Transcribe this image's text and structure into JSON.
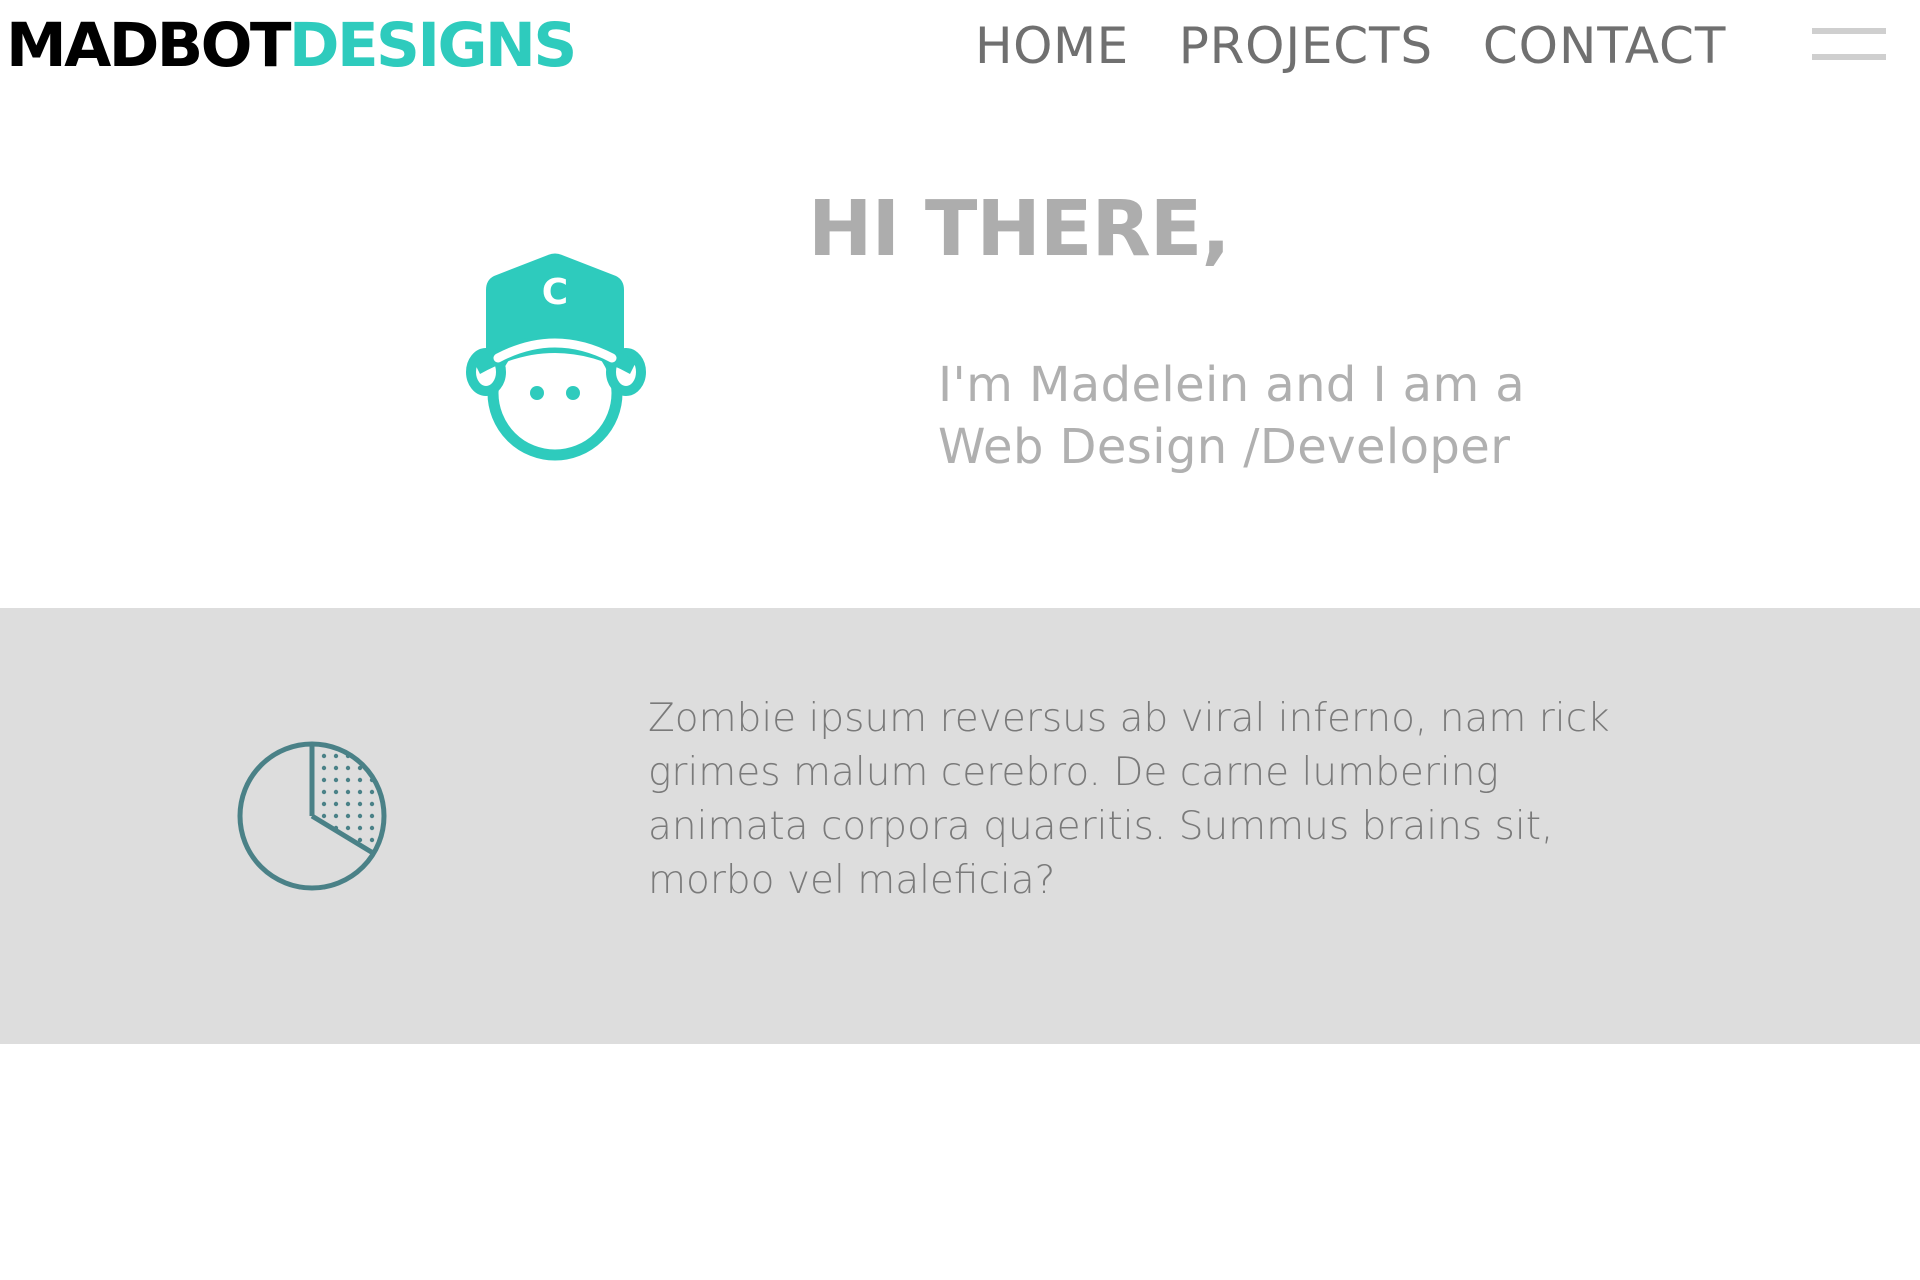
{
  "logo": {
    "part1": "MADBOT",
    "part2": "DESIGNS"
  },
  "nav": {
    "items": [
      {
        "label": "HOME"
      },
      {
        "label": "PROJECTS"
      },
      {
        "label": "CONTACT"
      }
    ],
    "menu_icon": "hamburger-menu-icon"
  },
  "hero": {
    "title": "HI THERE,",
    "subtitle_lines": [
      "I'm Madelein and I am a",
      "Web Design /Developer"
    ],
    "avatar_icon": "boy-with-cap-icon",
    "avatar_cap_letter": "C"
  },
  "about": {
    "icon": "pie-chart-icon",
    "text_lines": [
      "Zombie ipsum reversus ab viral inferno, nam rick",
      "grimes malum cerebro. De carne lumbering",
      "animata corpora quaeritis. Summus brains sit,",
      "morbo vel maleficia?"
    ]
  },
  "colors": {
    "accent": "#2ecbbd",
    "logo_dark": "#000000",
    "nav_text": "#707070",
    "title_grey": "#adadad",
    "band_bg": "#dddddd",
    "pie_stroke": "#4a8187"
  }
}
